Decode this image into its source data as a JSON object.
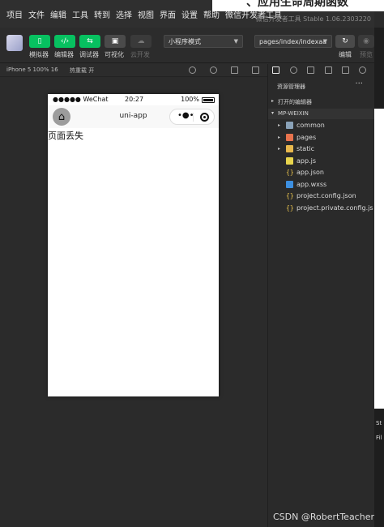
{
  "menu": {
    "items": [
      "项目",
      "文件",
      "编辑",
      "工具",
      "转到",
      "选择",
      "视图",
      "界面",
      "设置",
      "帮助",
      "微信开发者工具"
    ],
    "app_title": "微信开发者工具 Stable 1.06.2303220"
  },
  "background_heading": "、应用生命周期函数",
  "toolbar": {
    "simulator_label": "模拟器",
    "editor_label": "编辑器",
    "debugger_label": "调试器",
    "visual_label": "可视化",
    "cloud_label": "云开发",
    "mode_select": "小程序模式",
    "path_select": "pages/index/indexaa",
    "compile_label": "编辑",
    "preview_label": "预览"
  },
  "simbar": {
    "device": "iPhone 5 100% 16",
    "hot_reload": "热重载 开"
  },
  "phone": {
    "signal": "●●●●● WeChat",
    "time": "20:27",
    "battery": "100%",
    "nav_title": "uni-app",
    "page_text": "页面丢失"
  },
  "explorer": {
    "header": "资源管理器",
    "more": "···",
    "open_editors": "打开的编辑器",
    "project": "MP-WEIXIN",
    "tree": [
      {
        "name": "common",
        "type": "folder"
      },
      {
        "name": "pages",
        "type": "folder-pages"
      },
      {
        "name": "static",
        "type": "folder-static"
      },
      {
        "name": "app.js",
        "type": "js"
      },
      {
        "name": "app.json",
        "type": "json"
      },
      {
        "name": "app.wxss",
        "type": "wxss"
      },
      {
        "name": "project.config.json",
        "type": "json"
      },
      {
        "name": "project.private.config.js",
        "type": "json"
      }
    ]
  },
  "right_strip": {
    "text1": "St",
    "text2": "Fil"
  },
  "watermark": "CSDN @RobertTeacher",
  "colors": {
    "accent_green": "#07c160",
    "bg_dark": "#2b2b2b"
  }
}
